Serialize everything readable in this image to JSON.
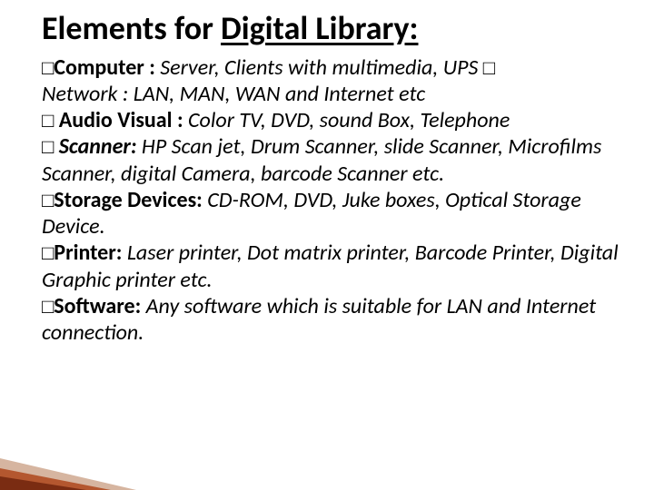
{
  "title_plain": "Elements for ",
  "title_underlined": "Digital Library:",
  "bullet_glyph": "□",
  "trailing_glyph": "□",
  "items": [
    {
      "label": "Computer : ",
      "text": "Server, Clients with multimedia, UPS ",
      "trail": true,
      "cont": "Network : LAN, MAN, WAN and Internet etc",
      "spaced": false
    },
    {
      "label": "Audio Visual : ",
      "text": "Color TV, DVD, sound Box, Telephone",
      "spaced": true
    },
    {
      "label": "Scanner: ",
      "text": "HP Scan jet, Drum Scanner, slide Scanner, Microfilms Scanner, digital Camera, barcode Scanner etc.",
      "label_italic": true,
      "spaced": true
    },
    {
      "label": "Storage Devices: ",
      "text": "CD-ROM, DVD, Juke boxes, Optical Storage Device.",
      "spaced": false
    },
    {
      "label": "Printer: ",
      "text": "Laser printer, Dot matrix printer, Barcode Printer, Digital Graphic printer etc.",
      "spaced": false
    },
    {
      "label": "Software: ",
      "text": "Any software which is suitable for LAN and Internet connection.",
      "spaced": false
    }
  ]
}
